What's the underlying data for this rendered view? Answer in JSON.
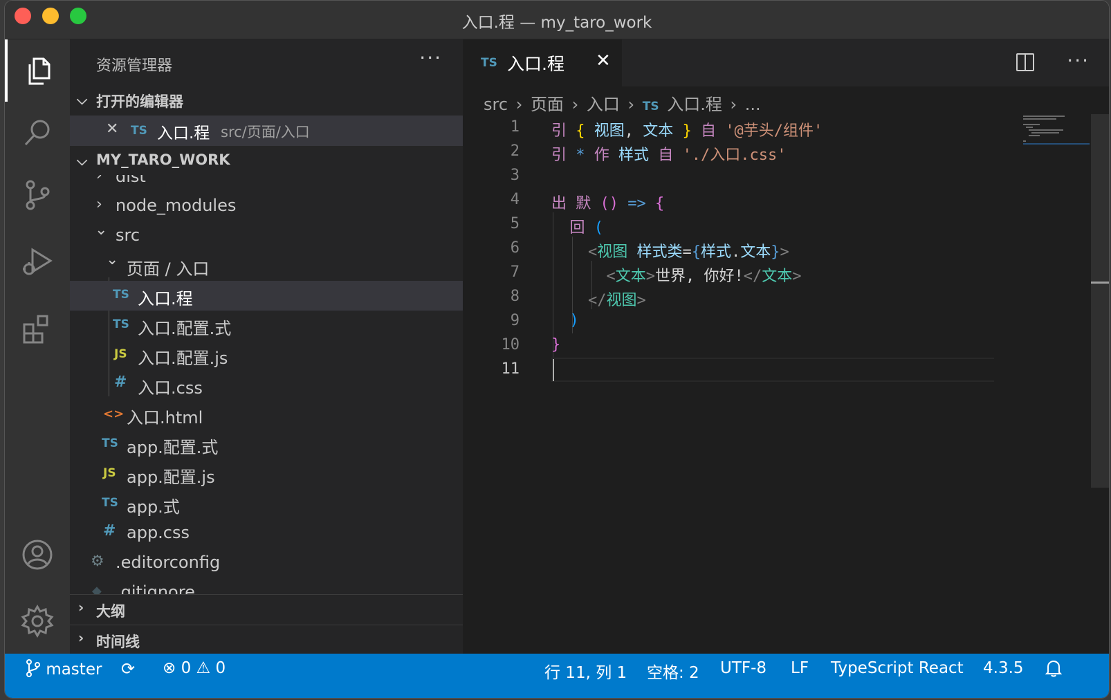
{
  "window": {
    "title": "入口.程 — my_taro_work"
  },
  "activity_bar": {
    "items": [
      {
        "name": "explorer-icon"
      },
      {
        "name": "search-icon"
      },
      {
        "name": "source-control-icon"
      },
      {
        "name": "run-debug-icon"
      },
      {
        "name": "extensions-icon"
      },
      {
        "name": "account-icon"
      },
      {
        "name": "settings-gear-icon"
      }
    ]
  },
  "sidebar": {
    "title": "资源管理器",
    "more": "···",
    "open_editors": {
      "label": "打开的编辑器",
      "items": [
        {
          "close": "✕",
          "badge": "TS",
          "name": "入口.程",
          "path": "src/页面/入口"
        }
      ]
    },
    "workspace": {
      "label": "MY_TARO_WORK",
      "tree": [
        {
          "label": "dist"
        },
        {
          "label": "node_modules",
          "chev": "›"
        },
        {
          "label": "src",
          "chev": "⌄"
        },
        {
          "label": "页面 / 入口",
          "chev": "⌄"
        },
        {
          "label": "入口.程",
          "badge": "TS"
        },
        {
          "label": "入口.配置.式",
          "badge": "TS"
        },
        {
          "label": "入口.配置.js",
          "badge": "JS"
        },
        {
          "label": "入口.css",
          "badge": "#"
        },
        {
          "label": "入口.html",
          "badge": "<>"
        },
        {
          "label": "app.配置.式",
          "badge": "TS"
        },
        {
          "label": "app.配置.js",
          "badge": "JS"
        },
        {
          "label": "app.式",
          "badge": "TS"
        },
        {
          "label": "app.css",
          "badge": "#"
        },
        {
          "label": ".editorconfig",
          "badge": "⚙"
        },
        {
          "label": ".gitignore",
          "badge": "◆"
        }
      ]
    },
    "outline": "大纲",
    "timeline": "时间线"
  },
  "editor": {
    "tab": {
      "badge": "TS",
      "name": "入口.程",
      "close": "✕"
    },
    "more": "···",
    "breadcrumb": [
      "src",
      "页面",
      "入口",
      "入口.程",
      "..."
    ],
    "breadcrumb_sep": "›",
    "lines": [
      {
        "n": "1"
      },
      {
        "n": "2"
      },
      {
        "n": "3"
      },
      {
        "n": "4"
      },
      {
        "n": "5"
      },
      {
        "n": "6"
      },
      {
        "n": "7"
      },
      {
        "n": "8"
      },
      {
        "n": "9"
      },
      {
        "n": "10"
      },
      {
        "n": "11"
      }
    ],
    "code": {
      "l1": {
        "kw": "引",
        "ob": "{",
        "a": "视图",
        "comma": ",",
        "b": "文本",
        "cb": "}",
        "from": "自",
        "str": "'@芋头/组件'"
      },
      "l2": {
        "kw": "引",
        "star": "*",
        "as": "作",
        "name": "样式",
        "from": "自",
        "str": "'./入口.css'"
      },
      "l4": {
        "kw": "出",
        "def": "默",
        "params": "()",
        "arrow": "=>",
        "ob": "{"
      },
      "l5": {
        "kw": "回",
        "paren": "("
      },
      "l6": {
        "lt": "<",
        "tag": "视图",
        "attr": "样式类",
        "eq": "=",
        "ob": "{",
        "obj": "样式",
        "dot": ".",
        "prop": "文本",
        "cb": "}",
        "gt": ">"
      },
      "l7": {
        "lt": "<",
        "tag": "文本",
        "gt": ">",
        "text": "世界, 你好!",
        "lt2": "</",
        "tag2": "文本",
        "gt2": ">"
      },
      "l8": {
        "lt": "</",
        "tag": "视图",
        "gt": ">"
      },
      "l9": {
        "paren": ")"
      },
      "l10": {
        "cb": "}"
      }
    }
  },
  "status_bar": {
    "branch": "master",
    "errors": "0",
    "warnings": "0",
    "position": "行 11, 列 1",
    "spaces": "空格: 2",
    "encoding": "UTF-8",
    "eol": "LF",
    "language": "TypeScript React",
    "version": "4.3.5"
  }
}
